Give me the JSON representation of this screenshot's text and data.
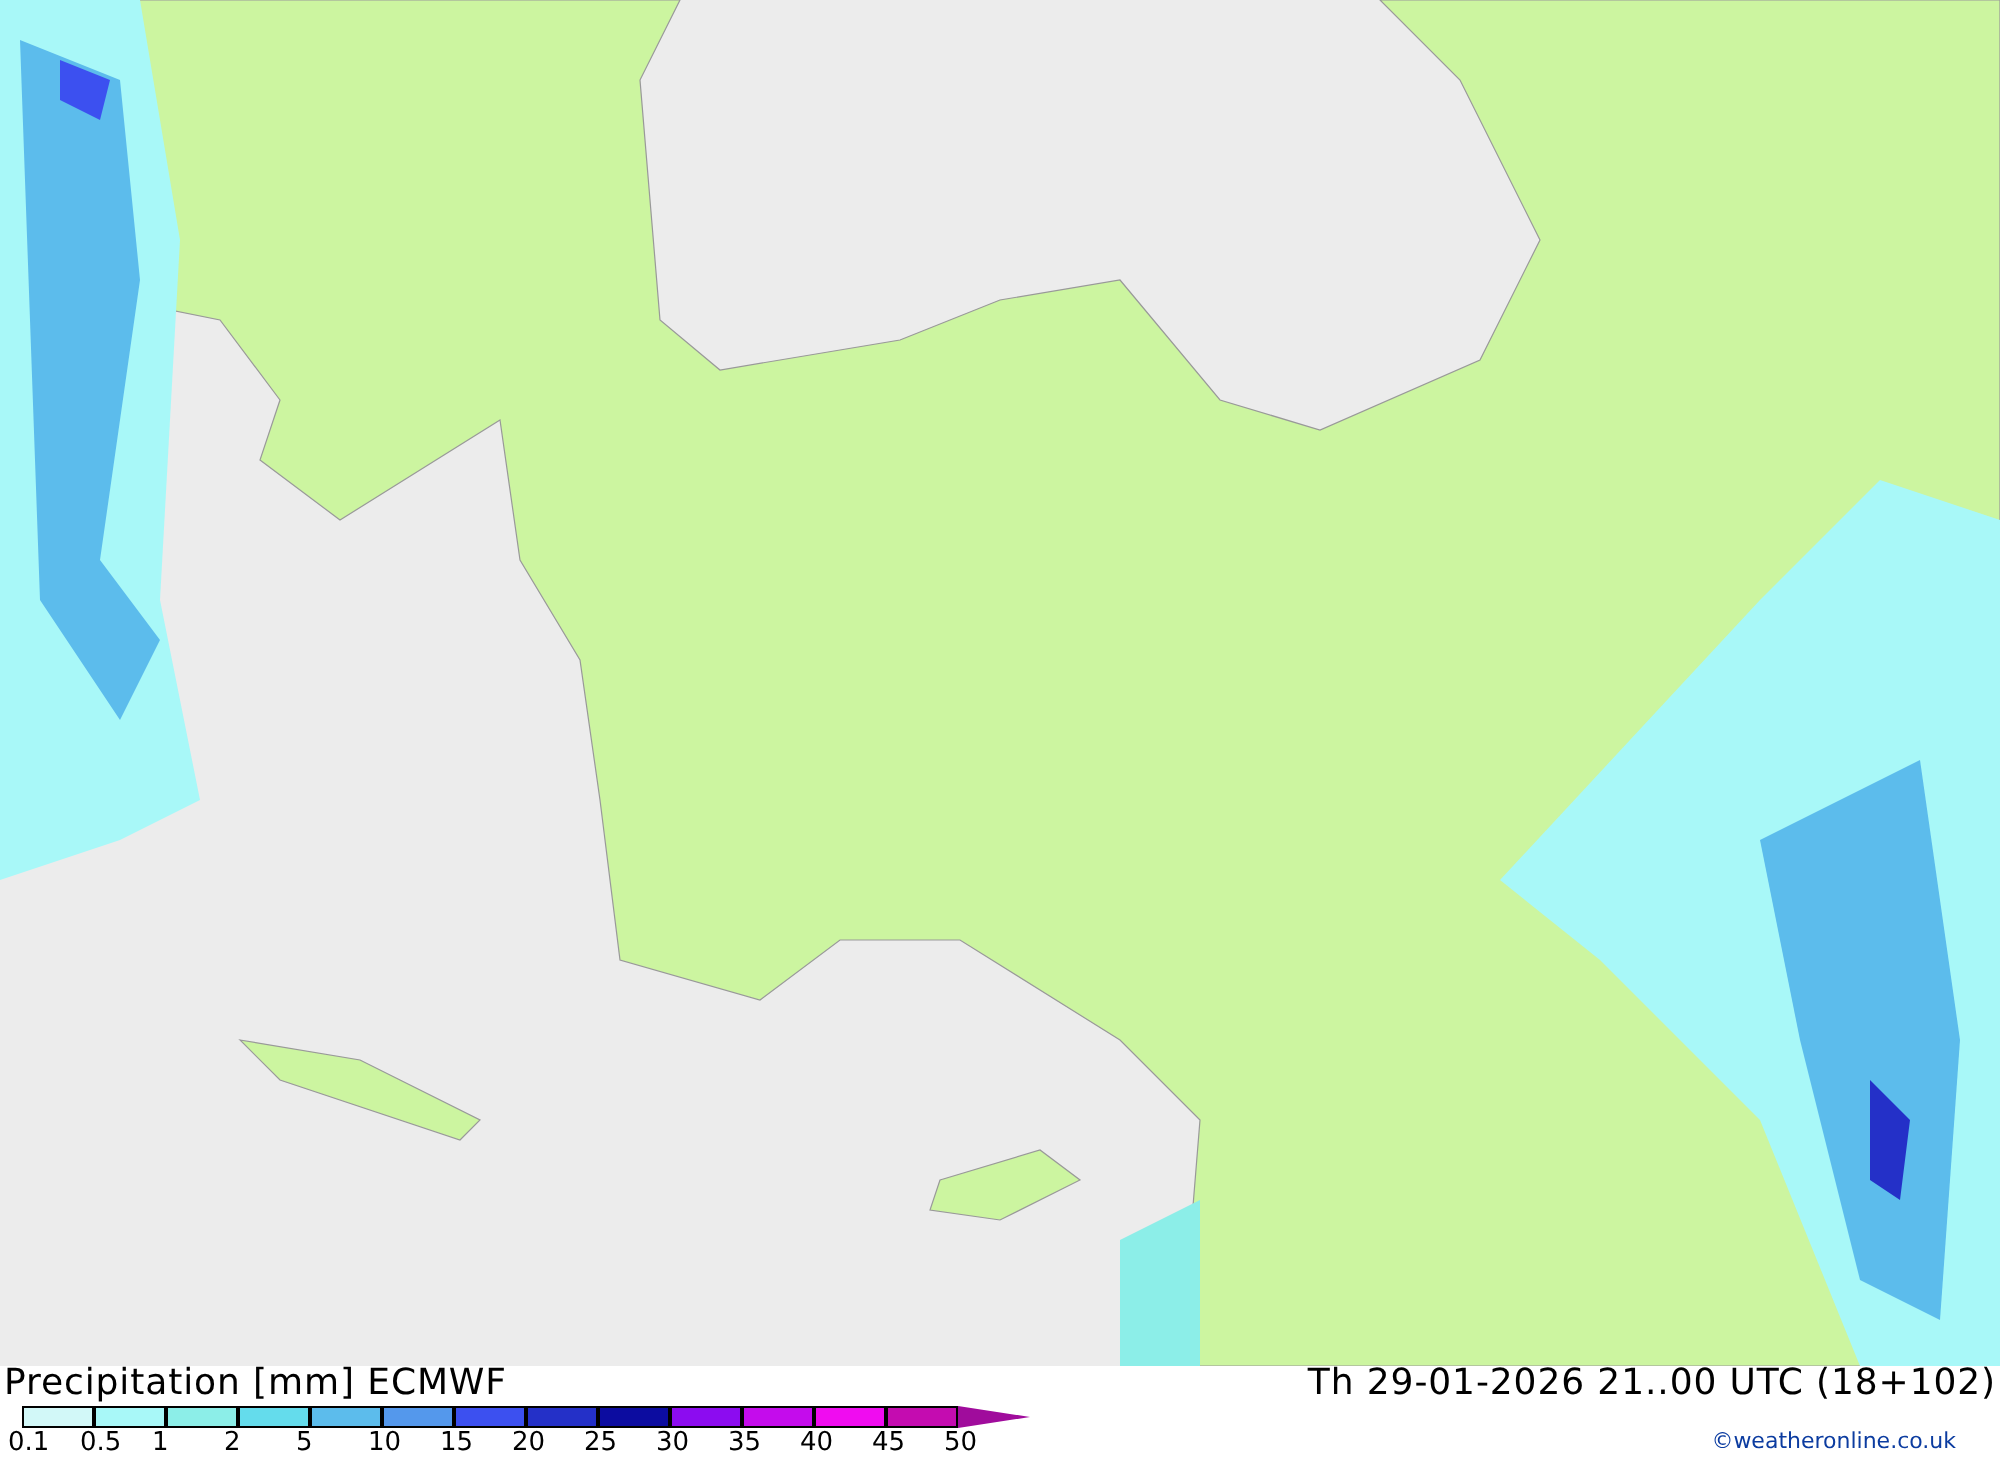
{
  "title": "Precipitation [mm] ECMWF",
  "valid_time": "Th 29-01-2026 21..00 UTC (18+102)",
  "scale_colors": [
    {
      "color": "#d2f8f8"
    },
    {
      "color": "#a8f8f8"
    },
    {
      "color": "#8ceee8"
    },
    {
      "color": "#64dcec"
    },
    {
      "color": "#5cbcec"
    },
    {
      "color": "#5498ec"
    },
    {
      "color": "#3c50f0"
    },
    {
      "color": "#2430c8"
    },
    {
      "color": "#0c0ca0"
    },
    {
      "color": "#8c0cf0"
    },
    {
      "color": "#c40cec"
    },
    {
      "color": "#f00cf0"
    },
    {
      "color": "#c40cb0"
    },
    {
      "color": "#a00c9c"
    }
  ],
  "scale_labels": [
    "0.1",
    "0.5",
    "1",
    "2",
    "5",
    "10",
    "15",
    "20",
    "25",
    "30",
    "35",
    "40",
    "45",
    "50"
  ],
  "copyright": "©weatheronline.co.uk"
}
